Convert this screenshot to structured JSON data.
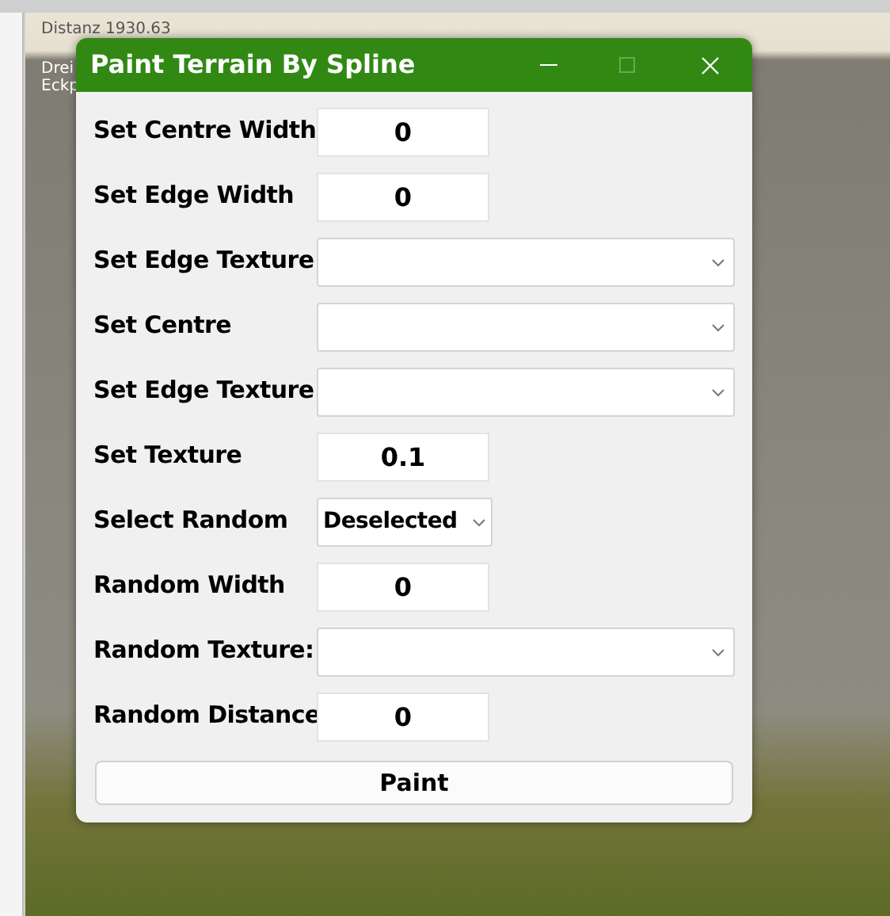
{
  "viewport": {
    "overlay_lines": [
      "Distanz 1930.63",
      "Drei",
      "Eckp"
    ]
  },
  "dialog": {
    "title": "Paint Terrain By Spline",
    "maximize_disabled": true,
    "rows": [
      {
        "label": "Set Centre Width",
        "kind": "number",
        "value": "0"
      },
      {
        "label": "Set Edge Width",
        "kind": "number",
        "value": "0"
      },
      {
        "label": "Set Edge Texture",
        "kind": "select"
      },
      {
        "label": "Set Centre",
        "kind": "select"
      },
      {
        "label": "Set Edge Texture",
        "kind": "select"
      },
      {
        "label": "Set Texture",
        "kind": "number",
        "value": "0.1"
      },
      {
        "label": "Select Random",
        "kind": "compact_select",
        "value": "Deselected"
      },
      {
        "label": "Random Width",
        "kind": "number",
        "value": "0"
      },
      {
        "label": "Random Texture:",
        "kind": "select"
      },
      {
        "label": "Random Distance",
        "kind": "number",
        "value": "0"
      }
    ],
    "button": "Paint"
  }
}
